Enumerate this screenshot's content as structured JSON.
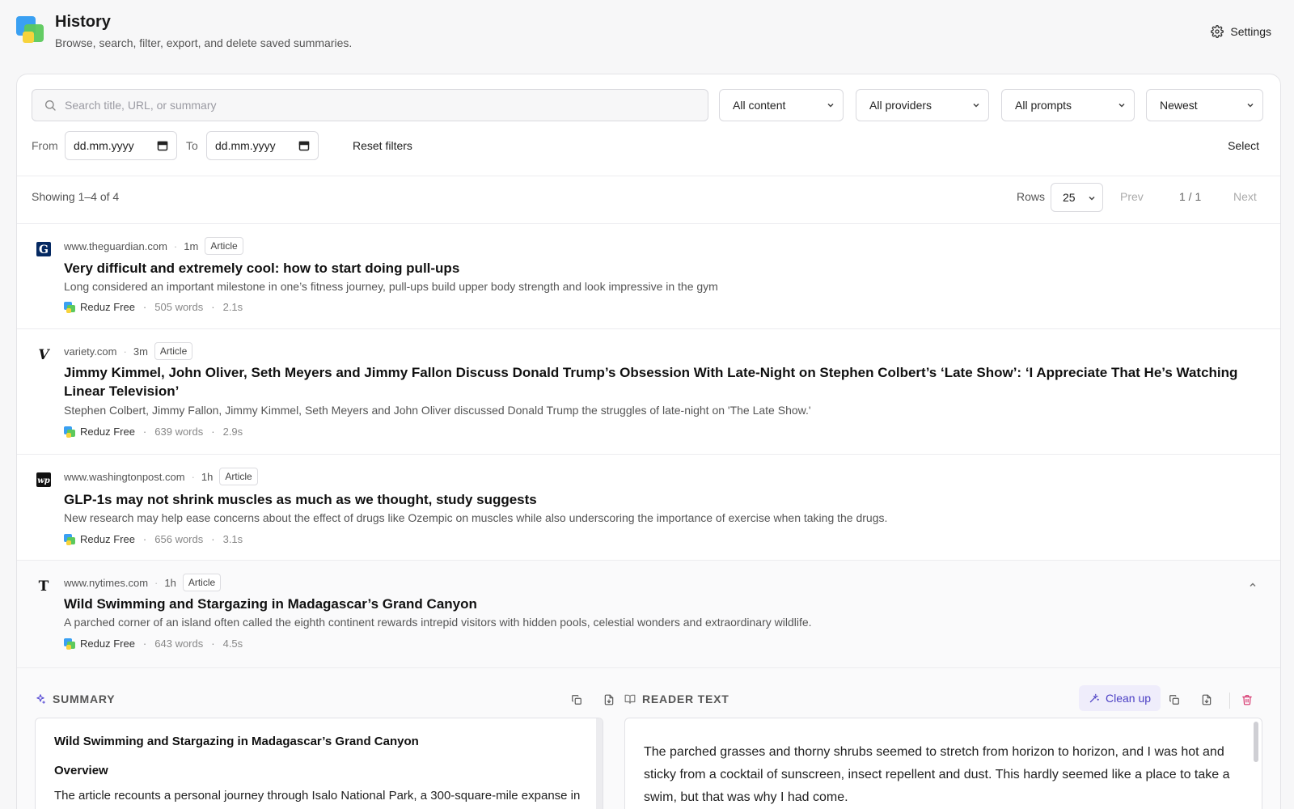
{
  "header": {
    "title": "History",
    "subtitle": "Browse, search, filter, export, and delete saved summaries.",
    "settings_label": "Settings"
  },
  "filters": {
    "search_placeholder": "Search title, URL, or summary",
    "content": "All content",
    "providers": "All providers",
    "prompts": "All prompts",
    "sort": "Newest",
    "from_label": "From",
    "from_value": "dd.mm.yyyy",
    "to_label": "To",
    "to_value": "dd.mm.yyyy",
    "reset_label": "Reset filters",
    "select_label": "Select"
  },
  "pagination": {
    "showing": "Showing 1–4 of 4",
    "rows_label": "Rows",
    "rows_value": "25",
    "prev": "Prev",
    "page": "1 / 1",
    "next": "Next"
  },
  "items": [
    {
      "domain": "www.theguardian.com",
      "age": "1m",
      "type": "Article",
      "title": "Very difficult and extremely cool: how to start doing pull-ups",
      "desc": "Long considered an important milestone in one’s fitness journey, pull-ups build upper body strength and look impressive in the gym",
      "provider": "Reduz Free",
      "words": "505 words",
      "time": "2.1s",
      "favicon": "guardian-icon"
    },
    {
      "domain": "variety.com",
      "age": "3m",
      "type": "Article",
      "title": "Jimmy Kimmel, John Oliver, Seth Meyers and Jimmy Fallon Discuss Donald Trump’s Obsession With Late-Night on Stephen Colbert’s ‘Late Show’: ‘I Appreciate That He’s Watching Linear Television’",
      "desc": "Stephen Colbert, Jimmy Fallon, Jimmy Kimmel, Seth Meyers and John Oliver discussed Donald Trump the struggles of late-night on 'The Late Show.'",
      "provider": "Reduz Free",
      "words": "639 words",
      "time": "2.9s",
      "favicon": "variety-icon"
    },
    {
      "domain": "www.washingtonpost.com",
      "age": "1h",
      "type": "Article",
      "title": "GLP-1s may not shrink muscles as much as we thought, study suggests",
      "desc": "New research may help ease concerns about the effect of drugs like Ozempic on muscles while also underscoring the importance of exercise when taking the drugs.",
      "provider": "Reduz Free",
      "words": "656 words",
      "time": "3.1s",
      "favicon": "washington-post-icon"
    },
    {
      "domain": "www.nytimes.com",
      "age": "1h",
      "type": "Article",
      "title": "Wild Swimming and Stargazing in Madagascar’s Grand Canyon",
      "desc": "A parched corner of an island often called the eighth continent rewards intrepid visitors with hidden pools, celestial wonders and extraordinary wildlife.",
      "provider": "Reduz Free",
      "words": "643 words",
      "time": "4.5s",
      "favicon": "nytimes-icon"
    }
  ],
  "detail": {
    "summary_label": "SUMMARY",
    "reader_label": "READER TEXT",
    "cleanup_label": "Clean up",
    "summary_title": "Wild Swimming and Stargazing in Madagascar’s Grand Canyon",
    "summary_heading": "Overview",
    "summary_body": "The article recounts a personal journey through Isalo National Park, a 300-square-mile expanse in",
    "reader_body": "The parched grasses and thorny shrubs seemed to stretch from horizon to horizon, and I was hot and sticky from a cocktail of sunscreen, insect repellent and dust. This hardly seemed like a place to take a swim, but that was why I had come."
  },
  "colors": {
    "accent": "#4b3fc4",
    "accent_bg": "#efedfb",
    "danger": "#d6336c",
    "brand_blue": "#3aa0f2",
    "brand_green": "#5cc95c",
    "brand_yellow": "#f7d33c"
  }
}
